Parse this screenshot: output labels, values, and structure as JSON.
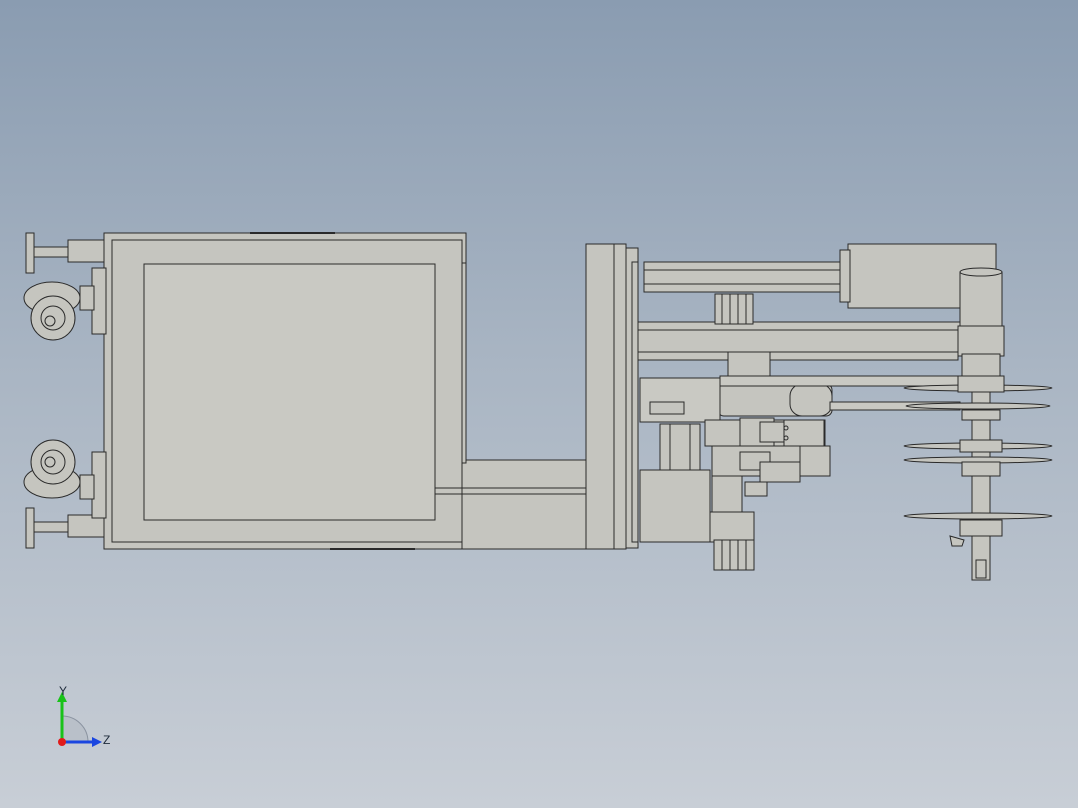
{
  "view": {
    "background_top": "#8a9cb1",
    "background_bottom": "#c8ced6",
    "part_fill": "#c5c5bf",
    "part_stroke": "#2a2a2a"
  },
  "triad": {
    "y_label": "Y",
    "z_label": "Z",
    "y_color": "#19c219",
    "z_color": "#1b46e0",
    "x_color": "#e01b1b"
  }
}
